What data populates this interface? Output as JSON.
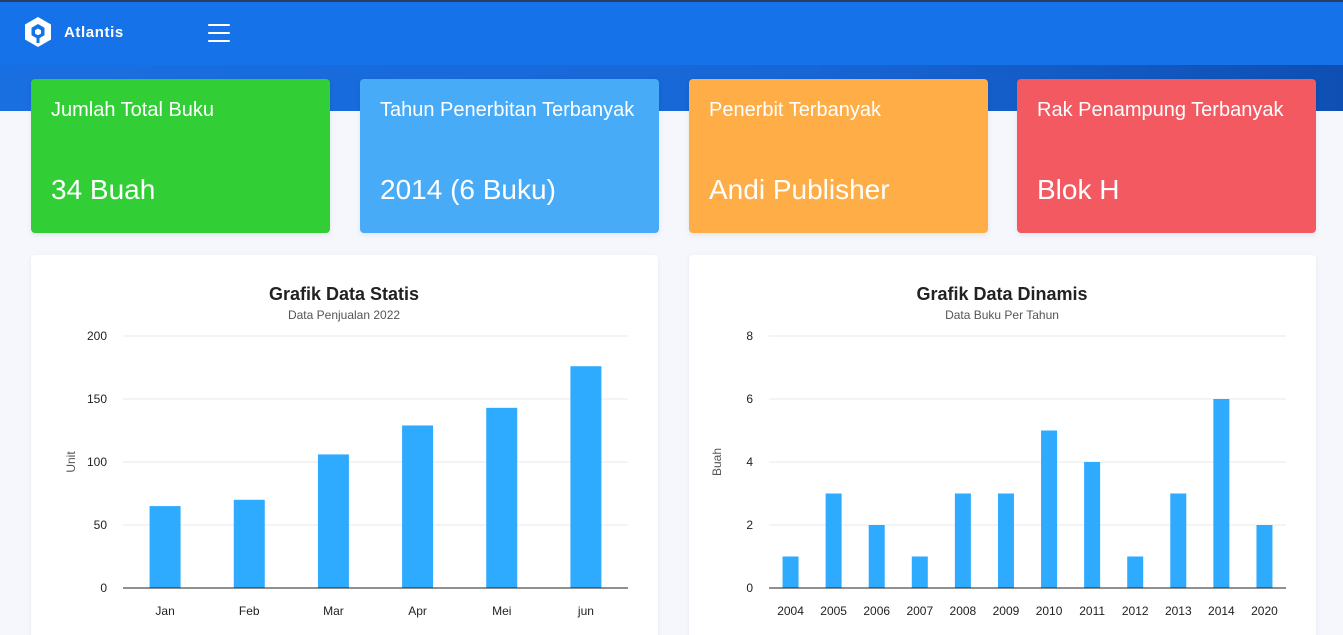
{
  "app": {
    "name": "Atlantis"
  },
  "stats": [
    {
      "title": "Jumlah Total Buku",
      "value": "34 Buah"
    },
    {
      "title": "Tahun Penerbitan Terbanyak",
      "value": "2014 (6 Buku)"
    },
    {
      "title": "Penerbit Terbanyak",
      "value": "Andi Publisher"
    },
    {
      "title": "Rak Penampung Terbanyak",
      "value": "Blok H"
    }
  ],
  "colors": {
    "navbar": "#1572e8",
    "green": "#31ce36",
    "blue": "#48abf7",
    "orange": "#ffad46",
    "red": "#f25961",
    "bar": "#2eaaff"
  },
  "chart_data": [
    {
      "type": "bar",
      "title": "Grafik Data Statis",
      "subtitle": "Data Penjualan 2022",
      "ylabel": "Unit",
      "xlabel": "",
      "categories": [
        "Jan",
        "Feb",
        "Mar",
        "Apr",
        "Mei",
        "jun"
      ],
      "values": [
        65,
        70,
        106,
        129,
        143,
        176
      ],
      "ylim": [
        0,
        200
      ],
      "yticks": [
        0,
        50,
        100,
        150,
        200
      ],
      "grid": true,
      "legend": "none"
    },
    {
      "type": "bar",
      "title": "Grafik Data Dinamis",
      "subtitle": "Data Buku Per Tahun",
      "ylabel": "Buah",
      "xlabel": "",
      "categories": [
        "2004",
        "2005",
        "2006",
        "2007",
        "2008",
        "2009",
        "2010",
        "2011",
        "2012",
        "2013",
        "2014",
        "2020"
      ],
      "values": [
        1,
        3,
        2,
        1,
        3,
        3,
        5,
        4,
        1,
        3,
        6,
        2
      ],
      "ylim": [
        0,
        8
      ],
      "yticks": [
        0,
        2,
        4,
        6,
        8
      ],
      "grid": true,
      "legend": "none"
    }
  ]
}
